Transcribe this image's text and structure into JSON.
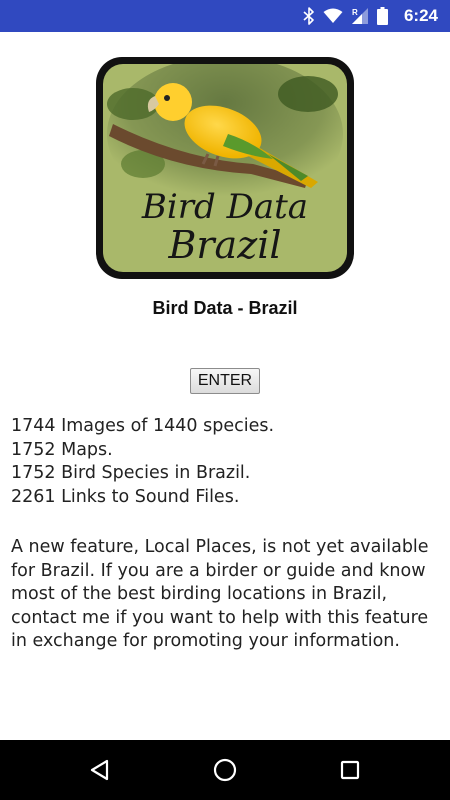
{
  "status_bar": {
    "time": "6:24",
    "icons": [
      "bluetooth-icon",
      "wifi-icon",
      "cell-signal-icon",
      "battery-icon"
    ],
    "signal_badge": "R",
    "color": "#3049c0"
  },
  "logo": {
    "line1": "Bird Data",
    "line2": "Brazil",
    "background": "#a9b86a"
  },
  "app_title": "Bird Data - Brazil",
  "enter_button": "ENTER",
  "stats": [
    "1744 Images of 1440 species.",
    "1752 Maps.",
    "1752 Bird Species in Brazil.",
    "2261 Links to Sound Files."
  ],
  "info": "A new feature, Local Places, is not yet available for Brazil. If you are a birder or guide and know most of the best birding locations in Brazil, contact me if you want to help with this feature in exchange for promoting your information.",
  "nav_bar": {
    "buttons": [
      "back-icon",
      "home-icon",
      "recent-apps-icon"
    ]
  }
}
